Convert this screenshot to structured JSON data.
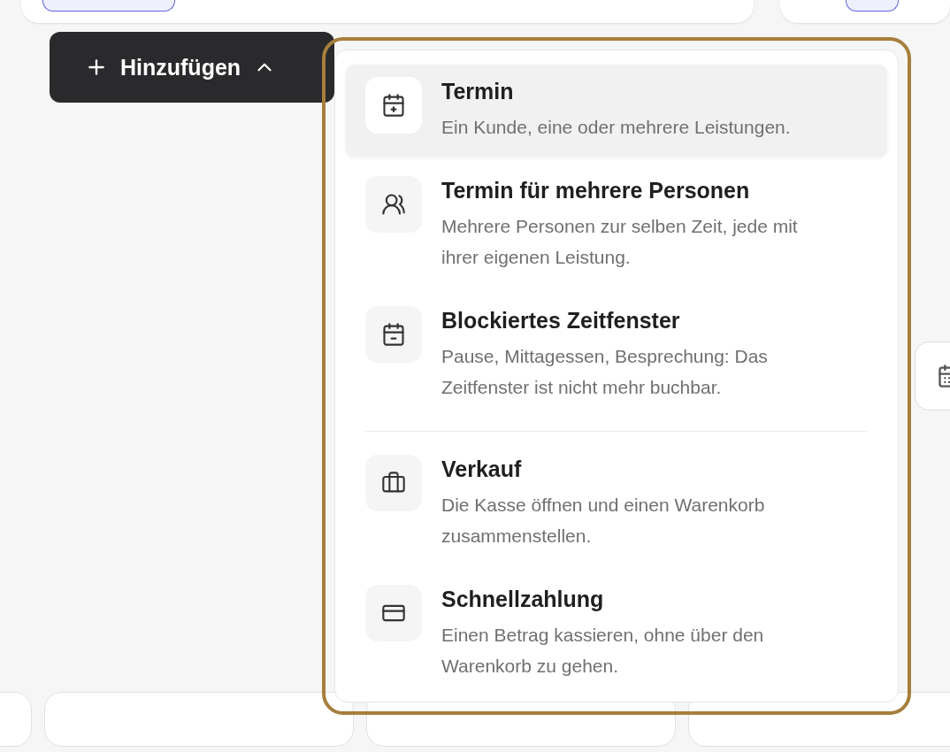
{
  "add_button": {
    "label": "Hinzufügen",
    "expanded": true
  },
  "menu": {
    "sections": [
      {
        "items": [
          {
            "kind": "appointment",
            "title": "Termin",
            "description": "Ein Kunde, eine oder mehrere Leistungen.",
            "selected": true
          },
          {
            "kind": "group",
            "title": "Termin für mehrere Personen",
            "description": "Mehrere Personen zur selben Zeit, jede mit ihrer eigenen Leistung.",
            "selected": false
          },
          {
            "kind": "block",
            "title": "Blockiertes Zeitfenster",
            "description": "Pause, Mittagessen, Besprechung: Das Zeitfenster ist nicht mehr buchbar.",
            "selected": false
          }
        ]
      },
      {
        "items": [
          {
            "kind": "sale",
            "title": "Verkauf",
            "description": "Die Kasse öffnen und einen Warenkorb zusammenstellen.",
            "selected": false
          },
          {
            "kind": "payment",
            "title": "Schnellzahlung",
            "description": "Einen Betrag kassieren, ohne über den Warenkorb zu gehen.",
            "selected": false
          }
        ]
      }
    ]
  }
}
